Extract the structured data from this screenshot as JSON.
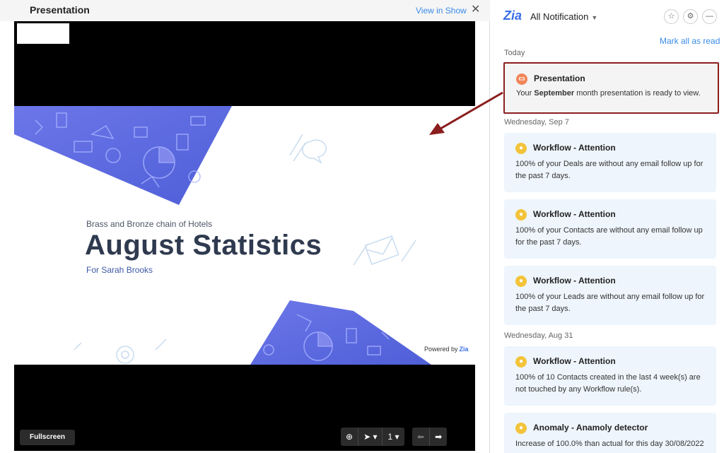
{
  "left": {
    "title": "Presentation",
    "view_in_show": "View in Show",
    "close": "✕",
    "fullscreen": "Fullscreen",
    "page_number": "1",
    "slide": {
      "subtitle": "Brass and Bronze chain of Hotels",
      "title": "August Statistics",
      "for_line": "For Sarah Brooks",
      "powered_by": "Powered by",
      "powered_logo": "Zia"
    }
  },
  "right": {
    "logo": "Zia",
    "title": "All Notification",
    "mark_all_read": "Mark all as read",
    "groups": {
      "today": "Today",
      "sep7": "Wednesday, Sep 7",
      "aug31": "Wednesday, Aug 31"
    },
    "cards": [
      {
        "title": "Presentation",
        "body_pre": "Your ",
        "body_bold": "September",
        "body_post": " month presentation is ready to view.",
        "icon": "presentation-icon"
      },
      {
        "title": "Workflow - Attention",
        "body": "100% of your Deals are without any email follow up for the past 7 days.",
        "icon": "bulb-icon"
      },
      {
        "title": "Workflow - Attention",
        "body": "100% of your Contacts are without any email follow up for the past 7 days.",
        "icon": "bulb-icon"
      },
      {
        "title": "Workflow - Attention",
        "body": "100% of your Leads are without any email follow up for the past 7 days.",
        "icon": "bulb-icon"
      },
      {
        "title": "Workflow - Attention",
        "body": "100% of 10 Contacts created in the last 4 week(s) are not touched by any Workflow rule(s).",
        "icon": "bulb-icon"
      },
      {
        "title": "Anomaly - Anamoly detector",
        "body": "Increase of 100.0% than actual for this day 30/08/2022",
        "icon": "bulb-icon"
      }
    ]
  },
  "colors": {
    "accent": "#3a8be8",
    "highlight_border": "#8b1e1e",
    "card_bg": "#eef5fc",
    "bulb": "#f3c43a",
    "slide_title": "#2f3a4f"
  }
}
